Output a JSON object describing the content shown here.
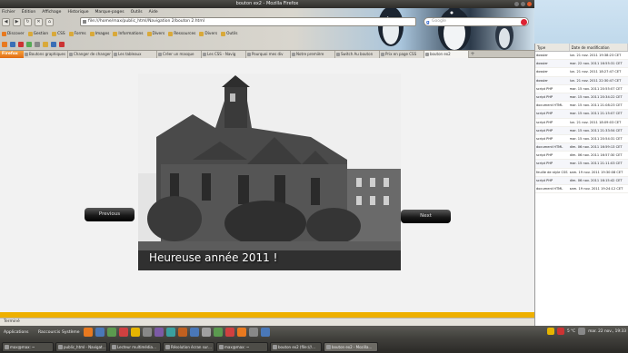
{
  "window": {
    "title": "bouton ex2 - Mozilla Firefox"
  },
  "menubar": [
    "Fichier",
    "Édition",
    "Affichage",
    "Historique",
    "Marque-pages",
    "Outils",
    "Aide"
  ],
  "navigation": {
    "url": "file:///home/max/public_html/Navigation 2/bouton 2.html",
    "search_placeholder": "Google"
  },
  "bookmarks": [
    "Discover",
    "Gestion",
    "CSS",
    "Forms",
    "Images",
    "Informations",
    "Divers",
    "Ressources",
    "Divers",
    "Outils"
  ],
  "tabs": [
    {
      "label": "Firefox",
      "active": false
    },
    {
      "label": "Boutons graphiques",
      "active": false
    },
    {
      "label": "Changer de changer",
      "active": false
    },
    {
      "label": "Les tableaux",
      "active": false
    },
    {
      "label": "Créer un masque",
      "active": false
    },
    {
      "label": "Les CSS - Navig",
      "active": false
    },
    {
      "label": "Pourquoi mes div",
      "active": false
    },
    {
      "label": "Notre première",
      "active": false
    },
    {
      "label": "Switch Au bouton",
      "active": false
    },
    {
      "label": "Prix en page CSS",
      "active": false
    },
    {
      "label": "bouton ex2",
      "active": true
    }
  ],
  "page": {
    "caption": "Heureuse année 2011 !",
    "previous_label": "Previous",
    "next_label": "Next"
  },
  "statusbar": {
    "text": "Terminé"
  },
  "file_manager": {
    "headers": [
      "Type",
      "Date de modification"
    ],
    "rows": [
      {
        "type": "dossier",
        "date": "lun. 21 nov. 2011 19:38:23 CET"
      },
      {
        "type": "dossier",
        "date": "mar. 22 nov. 2011 16:55:31 CET"
      },
      {
        "type": "dossier",
        "date": "lun. 21 nov. 2011 18:27:47 CET"
      },
      {
        "type": "dossier",
        "date": "lun. 21 nov. 2011 22:30:47 CET"
      },
      {
        "type": "script PHP",
        "date": "mar. 15 nov. 2011 20:55:07 CET"
      },
      {
        "type": "script PHP",
        "date": "mar. 15 nov. 2011 20:34:22 CET"
      },
      {
        "type": "document HTML",
        "date": "mar. 15 nov. 2011 21:08:23 CET"
      },
      {
        "type": "script PHP",
        "date": "mar. 15 nov. 2011 21:15:07 CET"
      },
      {
        "type": "script PHP",
        "date": "lun. 21 nov. 2011 18:09:03 CET"
      },
      {
        "type": "script PHP",
        "date": "mar. 15 nov. 2011 21:33:54 CET"
      },
      {
        "type": "script PHP",
        "date": "mar. 15 nov. 2011 20:54:31 CET"
      },
      {
        "type": "document HTML",
        "date": "dim. 06 nov. 2011 16:59:13 CET"
      },
      {
        "type": "script PHP",
        "date": "dim. 06 nov. 2011 16:57:30 CET"
      },
      {
        "type": "script PHP",
        "date": "mar. 15 nov. 2011 21:11:03 CET"
      },
      {
        "type": "feuille de style CSS",
        "date": "sam. 19 nov. 2011 19:30:08 CET"
      },
      {
        "type": "script PHP",
        "date": "dim. 06 nov. 2011 16:15:42 CET"
      },
      {
        "type": "document HTML",
        "date": "sam. 19 nov. 2011 19:24:12 CET"
      }
    ]
  },
  "top_panel": {
    "menus": [
      "Applications",
      "Raccourcis",
      "Système"
    ],
    "clock": "mar. 22 nov., 19:33",
    "temperature": "5 °C"
  },
  "taskbar": [
    {
      "label": "max@max: ~",
      "active": false
    },
    {
      "label": "public_html - Navigat…",
      "active": false
    },
    {
      "label": "Lecteur multimédia…",
      "active": false
    },
    {
      "label": "Résolution écran sur…",
      "active": false
    },
    {
      "label": "max@max: ~",
      "active": false
    },
    {
      "label": "bouton ex2 (file:///…",
      "active": false
    },
    {
      "label": "bouton ex2 - Mozilla…",
      "active": true
    }
  ],
  "colors": {
    "firefox_orange": "#e8791f",
    "scroll_accent": "#eeb000",
    "button_dark": "#1a1a1a"
  }
}
